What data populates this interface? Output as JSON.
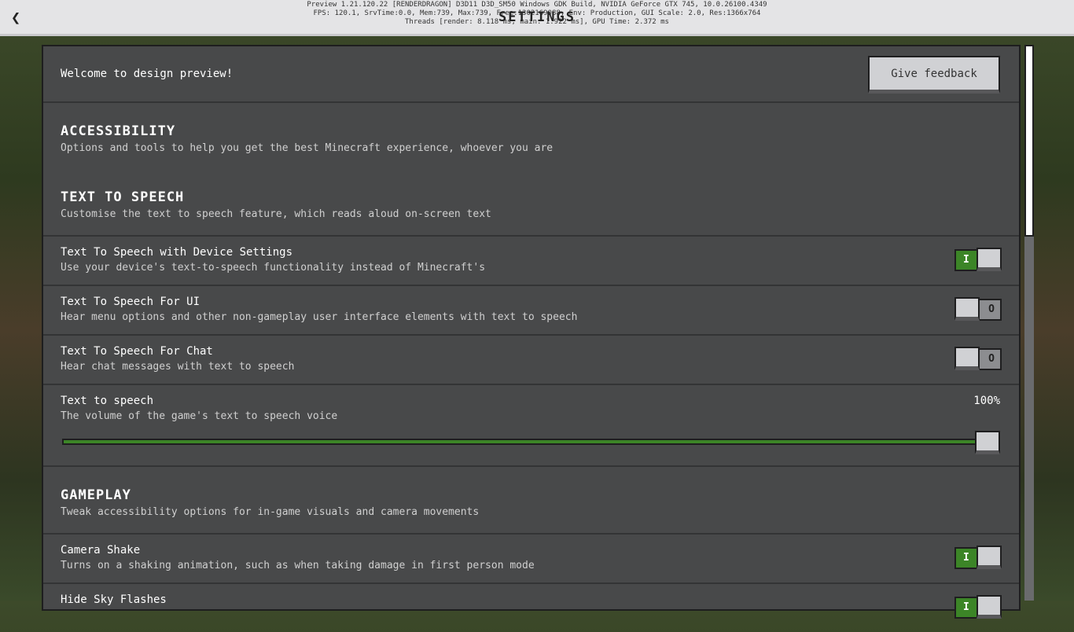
{
  "topbar": {
    "title": "SETTINGS",
    "debug": [
      "Preview 1.21.120.22 [RENDERDRAGON] D3D11 D3D_SM50 Windows GDK Build, NVIDIA GeForce GTX 745, 10.0.26100.4349",
      "FPS: 120.1, SrvTime:0.0, Mem:739, Max:739, Free:1302169088, Env: Production, GUI Scale: 2.0, Res:1366x764",
      "Threads [render: 8.118 ms, main: 1.922 ms], GPU Time: 2.372 ms"
    ]
  },
  "header": {
    "welcome": "Welcome to design preview!",
    "feedback": "Give feedback"
  },
  "sections": {
    "accessibility": {
      "title": "ACCESSIBILITY",
      "desc": "Options and tools to help you get the best Minecraft experience, whoever you are"
    },
    "tts": {
      "title": "TEXT TO SPEECH",
      "desc": "Customise the text to speech feature, which reads aloud on-screen text"
    },
    "gameplay": {
      "title": "GAMEPLAY",
      "desc": "Tweak accessibility options for in-game visuals and camera movements"
    }
  },
  "settings": [
    {
      "title": "Text To Speech with Device Settings",
      "desc": "Use your device's text-to-speech functionality instead of Minecraft's",
      "on": true
    },
    {
      "title": "Text To Speech For UI",
      "desc": "Hear menu options and other non-gameplay user interface elements with text to speech",
      "on": false
    },
    {
      "title": "Text To Speech For Chat",
      "desc": "Hear chat messages with text to speech",
      "on": false
    }
  ],
  "volume": {
    "title": "Text to speech",
    "desc": "The volume of the game's text to speech voice",
    "value": "100%",
    "fraction": 1.0
  },
  "gameplay_settings": [
    {
      "title": "Camera Shake",
      "desc": "Turns on a shaking animation, such as when taking damage in first person mode",
      "on": true
    },
    {
      "title": "Hide Sky Flashes",
      "desc": "",
      "on": true
    }
  ],
  "toggle_glyphs": {
    "on": "I",
    "off": "O"
  }
}
